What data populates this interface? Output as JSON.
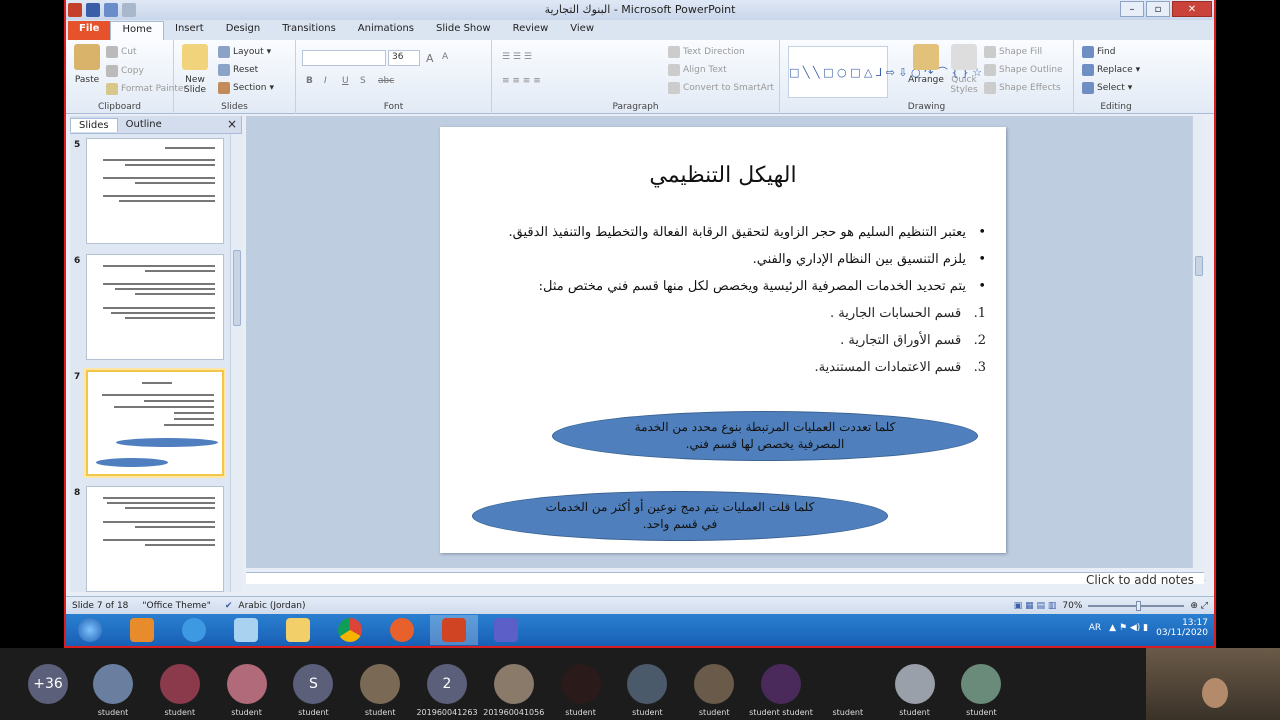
{
  "window": {
    "title": "البنوك التجارية  -  Microsoft PowerPoint"
  },
  "tabs": [
    "File",
    "Home",
    "Insert",
    "Design",
    "Transitions",
    "Animations",
    "Slide Show",
    "Review",
    "View"
  ],
  "ribbon": {
    "clipboard": {
      "paste": "Paste",
      "cut": "Cut",
      "copy": "Copy",
      "format_painter": "Format Painter",
      "label": "Clipboard"
    },
    "slides": {
      "new_slide": "New Slide",
      "layout": "Layout",
      "reset": "Reset",
      "section": "Section",
      "label": "Slides"
    },
    "font": {
      "size": "36",
      "label": "Font"
    },
    "paragraph": {
      "text_direction": "Text Direction",
      "align_text": "Align Text",
      "convert": "Convert to SmartArt",
      "label": "Paragraph"
    },
    "drawing": {
      "arrange": "Arrange",
      "quick_styles": "Quick Styles",
      "shape_fill": "Shape Fill",
      "shape_outline": "Shape Outline",
      "shape_effects": "Shape Effects",
      "label": "Drawing"
    },
    "editing": {
      "find": "Find",
      "replace": "Replace",
      "select": "Select",
      "label": "Editing"
    }
  },
  "panel": {
    "tabs": [
      "Slides",
      "Outline"
    ],
    "close": "×",
    "thumbs": [
      "5",
      "6",
      "7",
      "8"
    ]
  },
  "slide": {
    "title": "الهيكل التنظيمي",
    "bullets": [
      "يعتبر التنظيم السليم هو حجر الزاوية لتحقيق الرقابة الفعالة والتخطيط والتنفيذ الدقيق.",
      "يلزم التنسيق بين النظام الإداري والفني.",
      "يتم تحديد الخدمات المصرفية الرئيسية ويخصص لكل منها قسم فني مختص مثل:"
    ],
    "numbered": [
      {
        "n": "1.",
        "text": "قسم الحسابات الجارية ."
      },
      {
        "n": "2.",
        "text": "قسم الأوراق التجارية ."
      },
      {
        "n": "3.",
        "text": "قسم الاعتمادات المستندية."
      }
    ],
    "ellipse1": "كلما تعددت العمليات المرتبطة بنوع محدد من الخدمة المصرفية يخصص لها قسم فني.",
    "ellipse2": "كلما قلت العمليات يتم دمج نوعين أو أكثر من الخدمات في قسم واحد.",
    "notes": "Click to add notes"
  },
  "status": {
    "slide": "Slide 7 of 18",
    "theme": "\"Office Theme\"",
    "language": "Arabic (Jordan)",
    "zoom": "70%"
  },
  "tray": {
    "lang": "AR",
    "time": "13:17",
    "date": "03/11/2020"
  },
  "meeting": {
    "count": "+36",
    "participants": [
      {
        "initial": "",
        "name": "student",
        "color": "#6a7fa0"
      },
      {
        "initial": "",
        "name": "student",
        "color": "#8a3a4a"
      },
      {
        "initial": "",
        "name": "student",
        "color": "#b06a7a"
      },
      {
        "initial": "S",
        "name": "student",
        "color": "#5b5f7a"
      },
      {
        "initial": "",
        "name": "student",
        "color": "#7a6a55"
      },
      {
        "initial": "2",
        "name": "201960041263",
        "color": "#5b5f7a"
      },
      {
        "initial": "",
        "name": "201960041056",
        "color": "#8a7a6a"
      },
      {
        "initial": "",
        "name": "student",
        "color": "#2a1a1a"
      },
      {
        "initial": "",
        "name": "student",
        "color": "#4a5a6a"
      },
      {
        "initial": "",
        "name": "student",
        "color": "#6a5a4a"
      },
      {
        "initial": "",
        "name": "student student",
        "color": "#4a2a5a"
      },
      {
        "initial": "",
        "name": "student",
        "color": "#1c1c1c"
      },
      {
        "initial": "",
        "name": "student",
        "color": "#9aa0aa"
      },
      {
        "initial": "",
        "name": "student",
        "color": "#6a8a7a"
      }
    ]
  }
}
